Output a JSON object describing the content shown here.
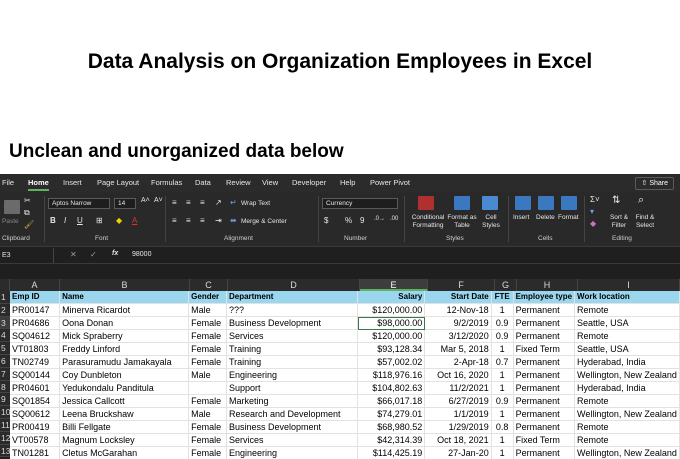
{
  "headline": "Data Analysis on Organization Employees in Excel",
  "subhead": "Unclean and unorganized data below",
  "menu": {
    "tabs": [
      "File",
      "Home",
      "Insert",
      "Page Layout",
      "Formulas",
      "Data",
      "Review",
      "View",
      "Developer",
      "Help",
      "Power Pivot"
    ],
    "active": "Home",
    "share": "Share"
  },
  "ribbon": {
    "clipboard": {
      "label": "Clipboard",
      "paste": "Paste"
    },
    "font": {
      "label": "Font",
      "name": "Aptos Narrow",
      "size": "14",
      "bold": "B",
      "italic": "I",
      "underline": "U"
    },
    "alignment": {
      "label": "Alignment",
      "wrap": "Wrap Text",
      "merge": "Merge & Center"
    },
    "number": {
      "label": "Number",
      "format": "Currency",
      "dollar": "$",
      "percent": "%",
      "comma": "9"
    },
    "styles": {
      "label": "Styles",
      "conditional": "Conditional Formatting",
      "format_table": "Format as Table",
      "cell_styles": "Cell Styles"
    },
    "cells": {
      "label": "Cells",
      "insert": "Insert",
      "delete": "Delete",
      "format": "Format"
    },
    "editing": {
      "label": "Editing",
      "sort": "Sort & Filter",
      "find": "Find & Select"
    }
  },
  "formula_bar": {
    "name_box": "E3",
    "fx": "fx",
    "value": "98000"
  },
  "columns": [
    "A",
    "B",
    "C",
    "D",
    "E",
    "F",
    "G",
    "H",
    "I"
  ],
  "selected_column": "E",
  "row_numbers": [
    "1",
    "2",
    "3",
    "4",
    "5",
    "6",
    "7",
    "8",
    "9",
    "10",
    "11",
    "12",
    "13"
  ],
  "headers": [
    "Emp ID",
    "Name",
    "Gender",
    "Department",
    "Salary",
    "Start Date",
    "FTE",
    "Employee type",
    "Work location"
  ],
  "rows": [
    [
      "PR00147",
      "Minerva Ricardot",
      "Male",
      "???",
      "$120,000.00",
      "12-Nov-18",
      "1",
      "Permanent",
      "Remote"
    ],
    [
      "PR04686",
      "Oona Donan",
      "Female",
      "Business Development",
      "$98,000.00",
      "9/2/2019",
      "0.9",
      "Permanent",
      "Seattle, USA"
    ],
    [
      "SQ04612",
      "Mick Spraberry",
      "Female",
      "Services",
      "$120,000.00",
      "3/12/2020",
      "0.9",
      "Permanent",
      "Remote"
    ],
    [
      "VT01803",
      "Freddy Linford",
      "Female",
      "Training",
      "$93,128.34",
      "Mar 5, 2018",
      "1",
      "Fixed Term",
      "Seattle, USA"
    ],
    [
      "TN02749",
      "Parasuramudu Jamakayala",
      "Female",
      "Training",
      "$57,002.02",
      "2-Apr-18",
      "0.7",
      "Permanent",
      "Hyderabad, India"
    ],
    [
      "SQ00144",
      "Coy Dunbleton",
      "Male",
      "Engineering",
      "$118,976.16",
      "Oct 16, 2020",
      "1",
      "Permanent",
      "Wellington, New Zealand"
    ],
    [
      "PR04601",
      "Yedukondalu Panditula",
      "",
      "Support",
      "$104,802.63",
      "11/2/2021",
      "1",
      "Permanent",
      "Hyderabad, India"
    ],
    [
      "SQ01854",
      "Jessica Callcott",
      "Female",
      "Marketing",
      "$66,017.18",
      "6/27/2019",
      "0.9",
      "Permanent",
      "Remote"
    ],
    [
      "SQ00612",
      "Leena Bruckshaw",
      "Male",
      "Research and Development",
      "$74,279.01",
      "1/1/2019",
      "1",
      "Permanent",
      "Wellington, New Zealand"
    ],
    [
      "PR00419",
      "Billi Fellgate",
      "Female",
      "Business Development",
      "$68,980.52",
      "1/29/2019",
      "0.8",
      "Permanent",
      "Remote"
    ],
    [
      "VT00578",
      "Magnum Locksley",
      "Female",
      "Services",
      "$42,314.39",
      "Oct 18, 2021",
      "1",
      "Fixed Term",
      "Remote"
    ],
    [
      "TN01281",
      "Cletus McGarahan",
      "Female",
      "Engineering",
      "$114,425.19",
      "27-Jan-20",
      "1",
      "Permanent",
      "Wellington, New Zealand"
    ]
  ],
  "colors": {
    "header_fill": "#9ad7ee",
    "excel_bg": "#1f1f1f",
    "accent": "#5fb05f"
  }
}
